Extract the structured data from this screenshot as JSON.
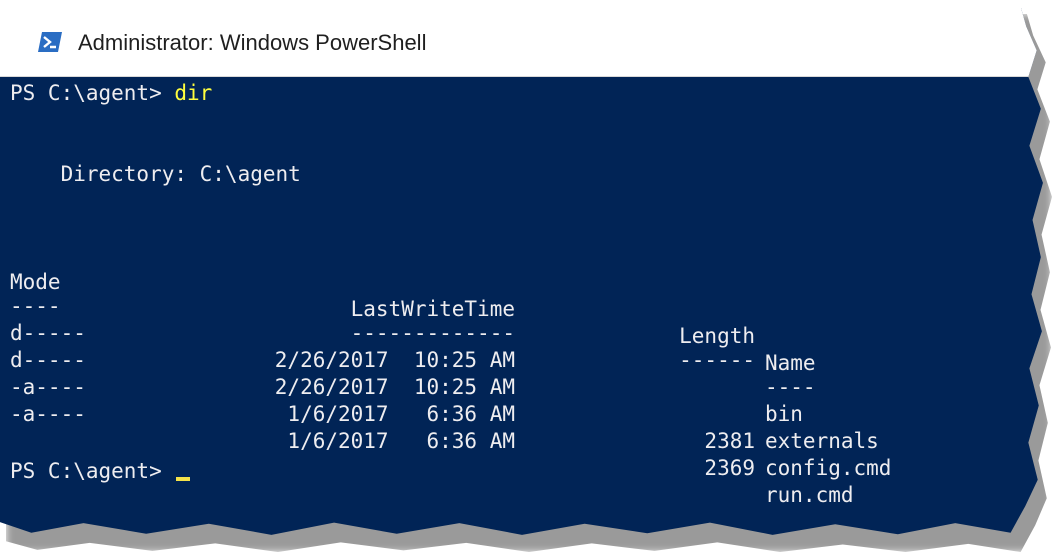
{
  "window": {
    "title": "Administrator: Windows PowerShell",
    "icon": "powershell-icon",
    "background_color": "#012456",
    "text_color": "#eeedf0",
    "command_color": "#fefe3e"
  },
  "console": {
    "prompt1": "PS C:\\agent> ",
    "command1": "dir",
    "directory_label": "    Directory: C:\\agent",
    "headers": {
      "mode": "Mode",
      "last_write_time": "LastWriteTime",
      "length": "Length",
      "name": "Name"
    },
    "underlines": {
      "mode": "----",
      "last_write_time": "-------------",
      "length": "------",
      "name": "----"
    },
    "entries": [
      {
        "mode": "d-----",
        "last_write_time": "2/26/2017  10:25 AM",
        "length": "",
        "name": "bin"
      },
      {
        "mode": "d-----",
        "last_write_time": "2/26/2017  10:25 AM",
        "length": "",
        "name": "externals"
      },
      {
        "mode": "-a----",
        "last_write_time": "1/6/2017   6:36 AM",
        "length": "2381",
        "name": "config.cmd"
      },
      {
        "mode": "-a----",
        "last_write_time": "1/6/2017   6:36 AM",
        "length": "2369",
        "name": "run.cmd"
      }
    ],
    "prompt2": "PS C:\\agent> "
  }
}
